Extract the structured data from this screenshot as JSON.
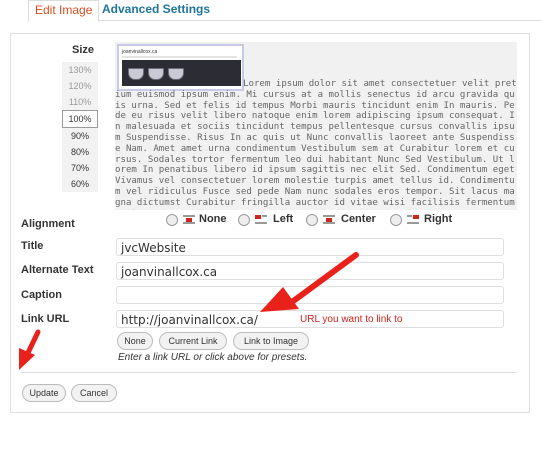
{
  "tabs": {
    "edit_image": "Edit Image",
    "advanced_settings": "Advanced Settings"
  },
  "size": {
    "label": "Size",
    "options": [
      "130%",
      "120%",
      "110%",
      "100%",
      "90%",
      "80%",
      "70%",
      "60%"
    ],
    "selected": "100%"
  },
  "preview": {
    "thumbnail_title": "joanvinallcox.ca",
    "text": "Lorem ipsum dolor sit amet consectetuer velit pretium euismod ipsum enim. Mi cursus at a mollis senectus id arcu gravida quis urna. Sed et felis id tempus Morbi mauris tincidunt enim In mauris. Pede eu risus velit libero natoque enim lorem adipiscing ipsum consequat. In malesuada et sociis tincidunt tempus pellentesque cursus convallis ipsum Suspendisse. Risus In ac quis ut Nunc convallis laoreet ante Suspendisse Nam. Amet amet urna condimentum Vestibulum sem at Curabitur lorem et cursus. Sodales tortor fermentum leo dui habitant Nunc Sed Vestibulum. Ut lorem In penatibus libero id ipsum sagittis nec elit Sed. Condimentum eget Vivamus vel consectetuer lorem molestie turpis amet tellus id. Condimentum vel ridiculus Fusce sed pede Nam nunc sodales eros tempor. Sit lacus magna dictumst Curabitur fringilla auctor id vitae wisi facilisis fermentum eget cursus."
  },
  "alignment": {
    "label": "Alignment",
    "options": [
      "None",
      "Left",
      "Center",
      "Right"
    ]
  },
  "fields": {
    "title": {
      "label": "Title",
      "value": "jvcWebsite"
    },
    "alt_text": {
      "label": "Alternate Text",
      "value": "joanvinallcox.ca"
    },
    "caption": {
      "label": "Caption",
      "value": ""
    },
    "link_url": {
      "label": "Link URL",
      "value": "http://joanvinallcox.ca/"
    }
  },
  "link_buttons": {
    "none": "None",
    "current_link": "Current Link",
    "link_to_image": "Link to Image"
  },
  "link_hint": "Enter a link URL or click above for presets.",
  "annotation": {
    "text": "URL you want to link to",
    "color": "#d2241b"
  },
  "actions": {
    "update": "Update",
    "cancel": "Cancel"
  },
  "colors": {
    "tab_active": "#d54e21",
    "tab_link": "#21759b",
    "arrow": "#e8221b"
  }
}
